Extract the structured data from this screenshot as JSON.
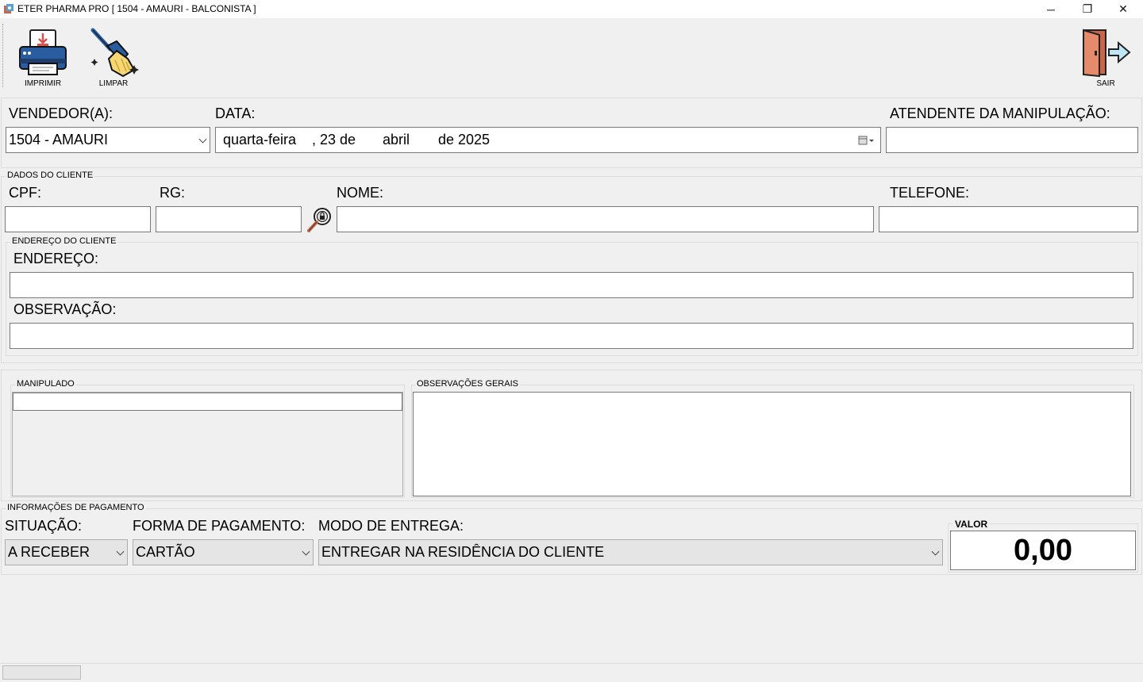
{
  "window": {
    "title": "ETER PHARMA PRO [ 1504 - AMAURI - BALCONISTA ]",
    "controls": {
      "minimize": "─",
      "restore": "❐",
      "close": "✕"
    }
  },
  "toolbar": {
    "print_label": "IMPRIMIR",
    "clear_label": "LIMPAR",
    "exit_label": "SAIR"
  },
  "header": {
    "seller_label": "VENDEDOR(A):",
    "seller_value": "1504 - AMAURI",
    "date_label": "DATA:",
    "date_weekday": "quarta-feira",
    "date_day": ", 23 de",
    "date_month": "abril",
    "date_year": "de 2025",
    "attendant_label": "ATENDENTE DA MANIPULAÇÃO:",
    "attendant_value": ""
  },
  "client": {
    "group_label": "DADOS DO CLIENTE",
    "cpf_label": "CPF:",
    "rg_label": "RG:",
    "name_label": "NOME:",
    "phone_label": "TELEFONE:",
    "address_group_label": "ENDEREÇO DO CLIENTE",
    "address_label": "ENDEREÇO:",
    "note_label": "OBSERVAÇÃO:"
  },
  "middle": {
    "manipulated_label": "MANIPULADO",
    "general_notes_label": "OBSERVAÇÕES GERAIS"
  },
  "payment": {
    "group_label": "INFORMAÇÕES DE PAGAMENTO",
    "status_label": "SITUAÇÃO:",
    "status_value": "A RECEBER",
    "method_label": "FORMA DE PAGAMENTO:",
    "method_value": "CARTÃO",
    "delivery_label": "MODO DE ENTREGA:",
    "delivery_value": "ENTREGAR NA RESIDÊNCIA DO CLIENTE",
    "value_label": "VALOR",
    "value": "0,00"
  },
  "icons": {
    "print": "printer-icon",
    "clear": "broom-icon",
    "exit": "exit-door-icon",
    "search": "search-client-icon",
    "calendar": "calendar-icon"
  }
}
